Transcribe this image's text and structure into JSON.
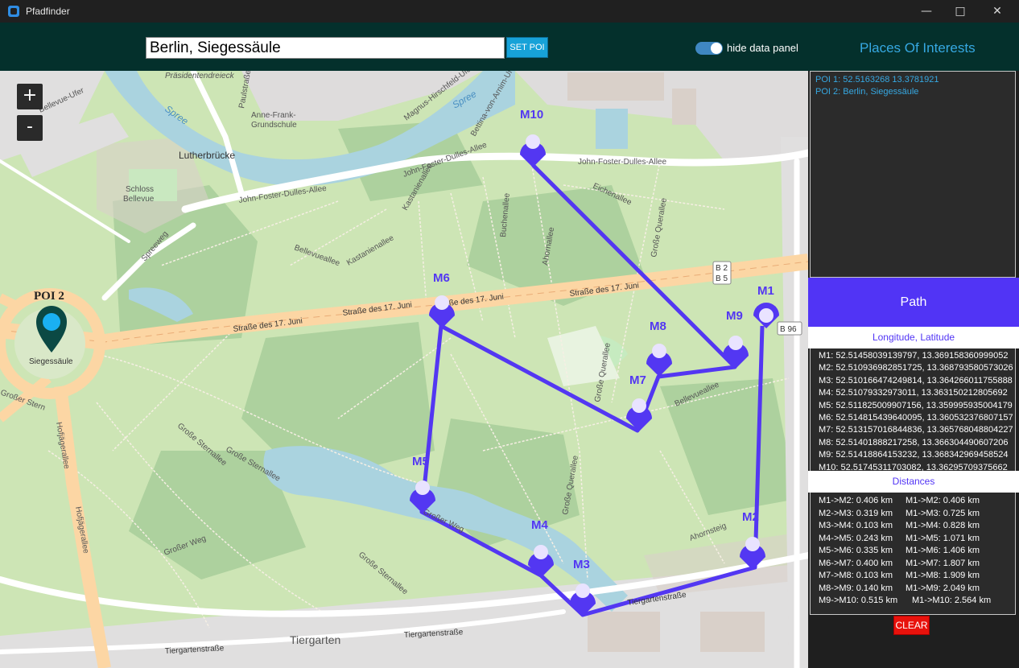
{
  "window": {
    "title": "Pfadfinder",
    "minimize_icon": "minimize-icon",
    "maximize_icon": "maximize-icon",
    "close_icon": "close-icon"
  },
  "toolbar": {
    "search_value": "Berlin, Siegessäule",
    "set_poi_label": "SET POI",
    "toggle_label": "hide data panel",
    "toggle_on": true,
    "heading": "Places Of Interests"
  },
  "map": {
    "zoom_in": "+",
    "zoom_out": "-",
    "labels": {
      "praesidentendreieck": "Präsidentendreieck",
      "anne_frank": "Anne-Frank-",
      "grundschule": "Grundschule",
      "lutherbruecke": "Lutherbrücke",
      "schloss": "Schloss",
      "bellevue": "Bellevue",
      "bellevue_ufer": "Bellevue-Ufer",
      "spree": "Spree",
      "spree2": "Spree",
      "magnus": "Magnus-Hirschfeld-Ufer",
      "bettina": "Bettina-von-Arnim-Ufer",
      "paulstrasse": "Paulstraße",
      "jfd1": "John-Foster-Dulles-Allee",
      "jfd2": "John-Foster-Dulles-Allee",
      "jfd3": "John-Foster-Dulles-Allee",
      "kastanienallee": "Kastanienallee",
      "kastanienallee2": "Kastanienallee",
      "buchenallee": "Buchenallee",
      "ahornallee": "Ahornallee",
      "eichenallee": "Eichenallee",
      "grosse_querallee": "Große Querallee",
      "grosse_querallee2": "Große Querallee",
      "grosse_querallee3": "Große Querallee",
      "spreeweg": "Spreeweg",
      "bellevueallee": "Bellevueallee",
      "s17_1": "Straße des 17. Juni",
      "s17_2": "Straße des 17. Juni",
      "s17_3": "Straße des 17. Juni",
      "s17_4": "Straße des 17. Juni",
      "b2": "B 2",
      "b5": "B 5",
      "b96": "B 96",
      "siegessaeule": "Siegessäule",
      "grosser_stern": "Großer Stern",
      "hofjaegerallee": "Hofjägerallee",
      "hofjaegerallee2": "Hofjägerallee",
      "grosse_sternallee": "Große Sternallee",
      "grosse_sternallee2": "Große Sternallee",
      "grosse_sternallee3": "Große Sternallee",
      "grosser_weg": "Großer Weg",
      "grosser_weg2": "Großer Weg",
      "bellevueallee2": "Bellevueallee",
      "ahornsteig": "Ahornsteig",
      "tiergartenstrasse": "Tiergartenstraße",
      "tiergartenstrasse2": "Tiergartenstraße",
      "tiergarten": "Tiergarten"
    },
    "poi_marker_label": "POI 2",
    "markers": [
      "M1",
      "M2",
      "M3",
      "M4",
      "M5",
      "M6",
      "M7",
      "M8",
      "M9",
      "M10"
    ],
    "route_color": "#5337f2",
    "poi_marker_color": "#1ab0f2"
  },
  "panel": {
    "pois": [
      "POI 1: 52.5163268 13.3781921",
      "POI 2: Berlin, Siegessäule"
    ],
    "path_title": "Path",
    "coords_title": "Longitude, Latitude",
    "coords": [
      "M1: 52.51458039139797, 13.369158360999052",
      "M2: 52.510936982851725, 13.368793580573026",
      "M3: 52.510166474249814, 13.364266011755888",
      "M4: 52.51079332973011, 13.363150212805692",
      "M5: 52.511825009907156, 13.359995935004179",
      "M6: 52.514815439640095, 13.360532376807157",
      "M7: 52.513157016844836, 13.365768048804227",
      "M8: 52.51401888217258, 13.366304490607206",
      "M9: 52.51418864153232, 13.368342969458524",
      "M10: 52.51745311703082, 13.36295709375662"
    ],
    "distances_title": "Distances",
    "distances": [
      [
        "M1->M2: 0.406 km",
        "M1->M2: 0.406 km"
      ],
      [
        "M2->M3: 0.319 km",
        "M1->M3: 0.725 km"
      ],
      [
        "M3->M4: 0.103 km",
        "M1->M4: 0.828 km"
      ],
      [
        "M4->M5: 0.243 km",
        "M1->M5: 1.071 km"
      ],
      [
        "M5->M6: 0.335 km",
        "M1->M6: 1.406 km"
      ],
      [
        "M6->M7: 0.400 km",
        "M1->M7: 1.807 km"
      ],
      [
        "M7->M8: 0.103 km",
        "M1->M8: 1.909 km"
      ],
      [
        "M8->M9: 0.140 km",
        "M1->M9: 2.049 km"
      ],
      [
        "M9->M10: 0.515 km",
        "M1->M10: 2.564 km"
      ]
    ],
    "clear_label": "CLEAR"
  }
}
